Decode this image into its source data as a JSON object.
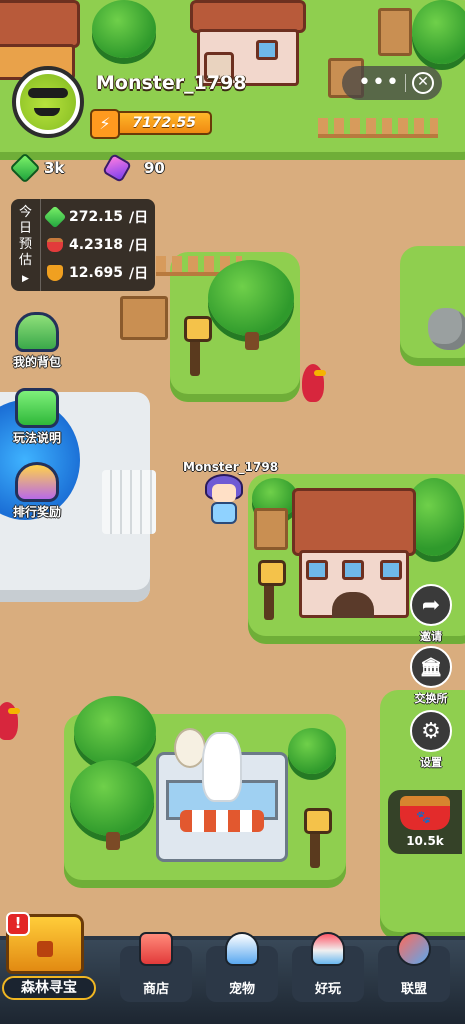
{
  "player": {
    "username": "Monster_1798",
    "power": "7172.55",
    "map_name": "Monster_1798"
  },
  "resources": {
    "green_gems": "3k",
    "purple_gems": "90"
  },
  "forecast": {
    "label_chars": [
      "今",
      "日",
      "预",
      "估"
    ],
    "play_symbol": "▶",
    "rows": [
      {
        "icon": "green-gem-icon",
        "value": "272.15",
        "unit": "/日"
      },
      {
        "icon": "food-can-icon",
        "value": "4.2318",
        "unit": "/日"
      },
      {
        "icon": "shield-icon",
        "value": "12.695",
        "unit": "/日"
      }
    ]
  },
  "left_menu": {
    "backpack": "我的背包",
    "how_to_play": "玩法说明",
    "ranking": "排行奖励"
  },
  "right_menu": {
    "invite": "邀请",
    "exchange": "交换所",
    "settings": "设置",
    "food": "10.5k"
  },
  "top_controls": {
    "more": "•••",
    "close": "✕"
  },
  "bottom_nav": {
    "treasure": "森林寻宝",
    "alert": "!",
    "items": [
      {
        "label": "商店",
        "icon": "shop-icon",
        "color": "#e8544a"
      },
      {
        "label": "宠物",
        "icon": "pet-icon",
        "color": "#3a8ae8"
      },
      {
        "label": "好玩",
        "icon": "arcade-icon",
        "color": "#e23a5a"
      },
      {
        "label": "联盟",
        "icon": "handshake-icon",
        "color": "#4a90e2"
      }
    ]
  },
  "colors": {
    "grass": "#8fcf4f",
    "path": "#d9ad7e",
    "accent": "#f0b622"
  }
}
